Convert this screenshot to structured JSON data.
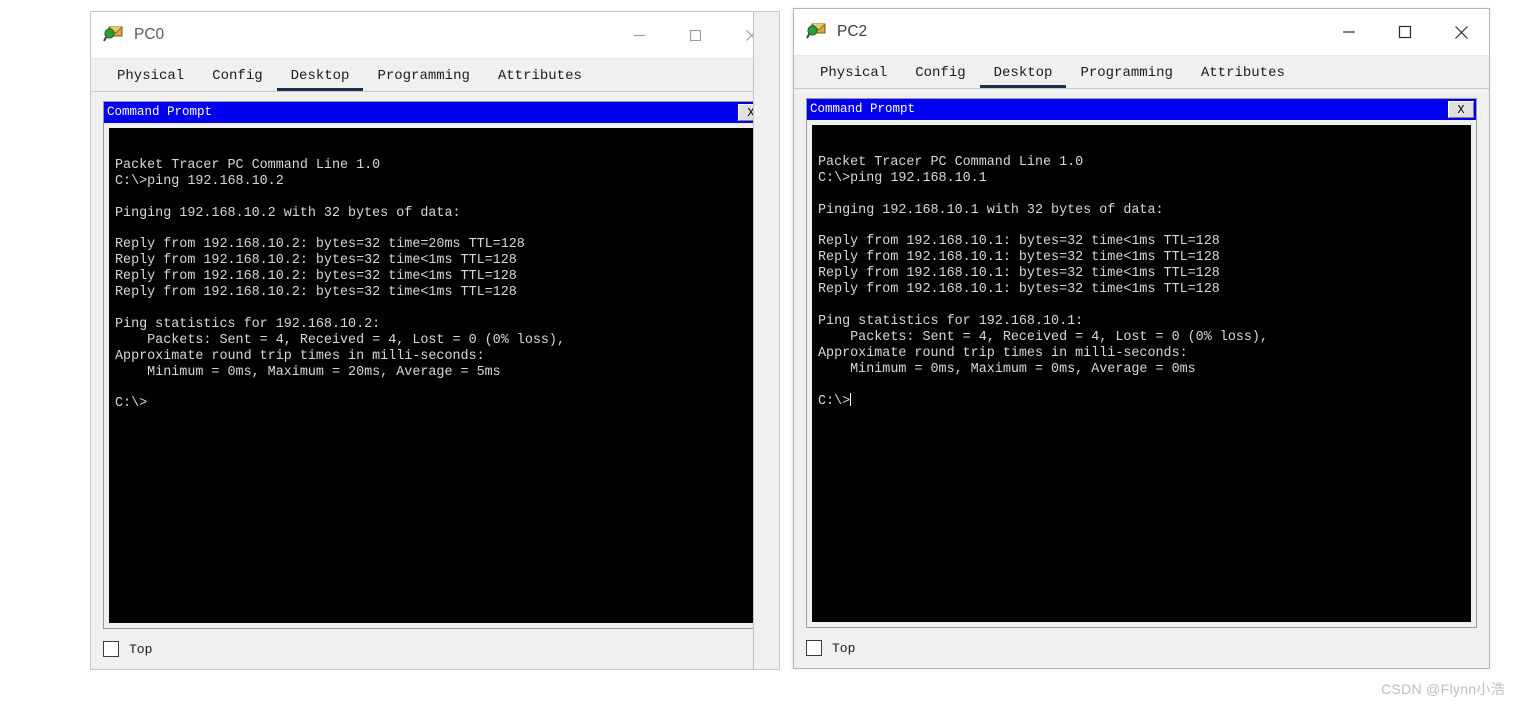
{
  "windows": [
    {
      "id": "pc0",
      "title": "PC0",
      "icon": "packet-tracer-pc-icon",
      "active": false,
      "controls": {
        "minimize": "minimize-icon",
        "maximize": "maximize-icon",
        "close": "close-icon"
      },
      "tabs": [
        {
          "label": "Physical",
          "selected": false
        },
        {
          "label": "Config",
          "selected": false
        },
        {
          "label": "Desktop",
          "selected": true
        },
        {
          "label": "Programming",
          "selected": false
        },
        {
          "label": "Attributes",
          "selected": false
        }
      ],
      "app": {
        "title": "Command Prompt",
        "close_label": "X",
        "lines": [
          "",
          "Packet Tracer PC Command Line 1.0",
          "C:\\>ping 192.168.10.2",
          "",
          "Pinging 192.168.10.2 with 32 bytes of data:",
          "",
          "Reply from 192.168.10.2: bytes=32 time=20ms TTL=128",
          "Reply from 192.168.10.2: bytes=32 time<1ms TTL=128",
          "Reply from 192.168.10.2: bytes=32 time<1ms TTL=128",
          "Reply from 192.168.10.2: bytes=32 time<1ms TTL=128",
          "",
          "Ping statistics for 192.168.10.2:",
          "    Packets: Sent = 4, Received = 4, Lost = 0 (0% loss),",
          "Approximate round trip times in milli-seconds:",
          "    Minimum = 0ms, Maximum = 20ms, Average = 5ms",
          "",
          "C:\\>"
        ],
        "cursor_visible": false
      },
      "footer": {
        "checkbox_label": "Top",
        "checked": false
      }
    },
    {
      "id": "pc2",
      "title": "PC2",
      "icon": "packet-tracer-pc-icon",
      "active": true,
      "controls": {
        "minimize": "minimize-icon",
        "maximize": "maximize-icon",
        "close": "close-icon"
      },
      "tabs": [
        {
          "label": "Physical",
          "selected": false
        },
        {
          "label": "Config",
          "selected": false
        },
        {
          "label": "Desktop",
          "selected": true
        },
        {
          "label": "Programming",
          "selected": false
        },
        {
          "label": "Attributes",
          "selected": false
        }
      ],
      "app": {
        "title": "Command Prompt",
        "close_label": "X",
        "lines": [
          "",
          "Packet Tracer PC Command Line 1.0",
          "C:\\>ping 192.168.10.1",
          "",
          "Pinging 192.168.10.1 with 32 bytes of data:",
          "",
          "Reply from 192.168.10.1: bytes=32 time<1ms TTL=128",
          "Reply from 192.168.10.1: bytes=32 time<1ms TTL=128",
          "Reply from 192.168.10.1: bytes=32 time<1ms TTL=128",
          "Reply from 192.168.10.1: bytes=32 time<1ms TTL=128",
          "",
          "Ping statistics for 192.168.10.1:",
          "    Packets: Sent = 4, Received = 4, Lost = 0 (0% loss),",
          "Approximate round trip times in milli-seconds:",
          "    Minimum = 0ms, Maximum = 0ms, Average = 0ms",
          "",
          "C:\\>"
        ],
        "cursor_visible": true
      },
      "footer": {
        "checkbox_label": "Top",
        "checked": false
      }
    }
  ],
  "watermark": {
    "text": "CSDN @Flynn小浩"
  },
  "colors": {
    "app_titlebar": "#0000EE",
    "terminal_bg": "#000000",
    "terminal_fg": "#D8D8D8",
    "tab_selected_underline": "#1C3050",
    "window_chrome": "#F0F0F0"
  }
}
